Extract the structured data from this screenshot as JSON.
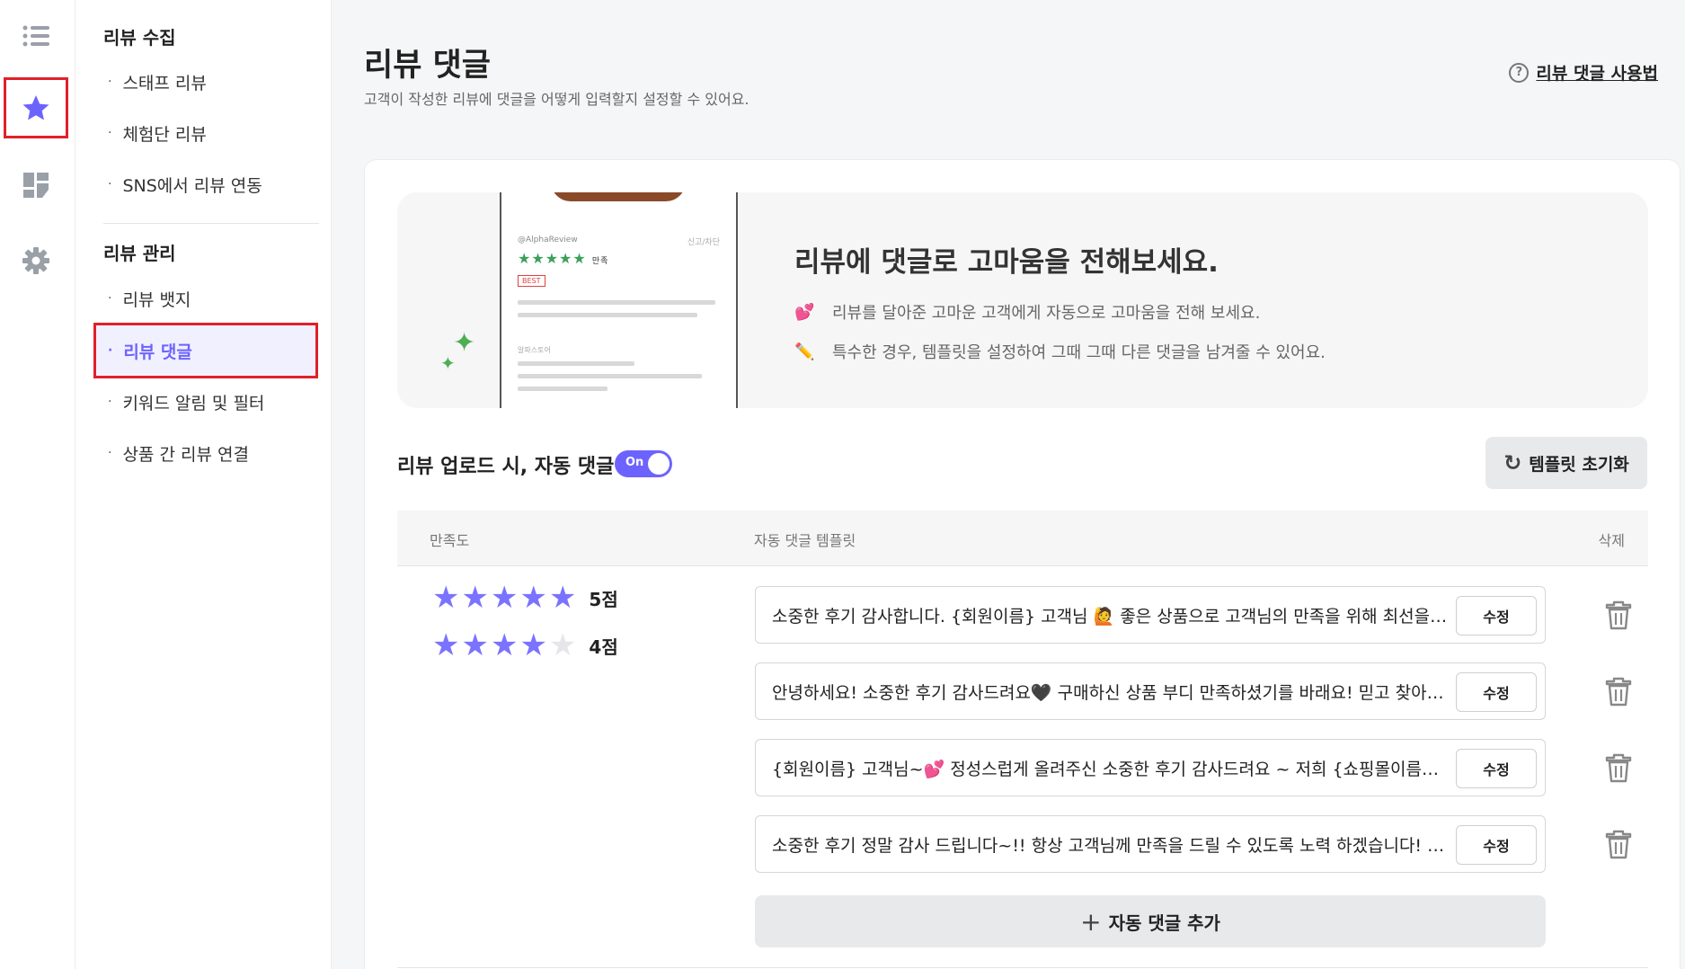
{
  "rail": {
    "items": [
      {
        "icon": "list-icon"
      },
      {
        "icon": "star-icon",
        "active": true
      },
      {
        "icon": "dashboard-icon"
      },
      {
        "icon": "gear-icon"
      }
    ]
  },
  "subnav": {
    "groups": [
      {
        "title": "리뷰 수집",
        "items": [
          "스태프 리뷰",
          "체험단 리뷰",
          "SNS에서 리뷰 연동"
        ]
      },
      {
        "title": "리뷰 관리",
        "items": [
          "리뷰 뱃지",
          "리뷰 댓글",
          "키워드 알림 및 필터",
          "상품 간 리뷰 연결"
        ]
      }
    ],
    "active_item": "리뷰 댓글"
  },
  "header": {
    "title": "리뷰 댓글",
    "description": "고객이 작성한 리뷰에 댓글을 어떻게 입력할지 설정할 수 있어요.",
    "help_link": "리뷰 댓글 사용법"
  },
  "banner": {
    "title": "리뷰에 댓글로 고마움을 전해보세요.",
    "lines": [
      "리뷰를 달아준 고마운 고객에게 자동으로 고마움을 전해 보세요.",
      "특수한 경우, 템플릿을 설정하여 그때 그때 다른 댓글을 남겨줄 수 있어요."
    ],
    "line_emojis": [
      "💕",
      "✏️"
    ],
    "phone": {
      "user": "@AlphaReview",
      "report": "신고/차단",
      "rating_text": "만족",
      "best": "BEST",
      "shop_label": "알파스토어"
    }
  },
  "auto_comment": {
    "label": "리뷰 업로드 시, 자동 댓글",
    "toggle_text": "On",
    "enabled": true,
    "reset_button": "템플릿 초기화"
  },
  "table": {
    "columns": [
      "만족도",
      "자동 댓글 템플릿",
      "삭제"
    ],
    "ratings": [
      {
        "stars": 5,
        "label": "5점"
      },
      {
        "stars": 4,
        "label": "4점"
      }
    ],
    "templates": [
      "소중한 후기 감사합니다. {회원이름} 고객님 🙋 좋은 상품으로 고객님의 만족을 위해 최선을 다하겠습니다.",
      "안녕하세요! 소중한 후기 감사드려요🖤 구매하신 상품 부디 만족하셨기를 바래요! 믿고 찾아주셔서 감사합니다.",
      "{회원이름} 고객님~💕 정성스럽게 올려주신 소중한 후기 감사드려요 ~ 저희 {쇼핑몰이름}을 이용해주셔서 감사합니다.",
      "소중한 후기 정말 감사 드립니다~!! 항상 고객님께 만족을 드릴 수 있도록 노력 하겠습니다! 감사합니다."
    ],
    "edit_label": "수정",
    "add_button": "자동 댓글 추가"
  },
  "colors": {
    "accent": "#6c63ff",
    "star_on": "#7b73ff",
    "star_off": "#e6e6ea",
    "highlight": "#e0202a"
  }
}
